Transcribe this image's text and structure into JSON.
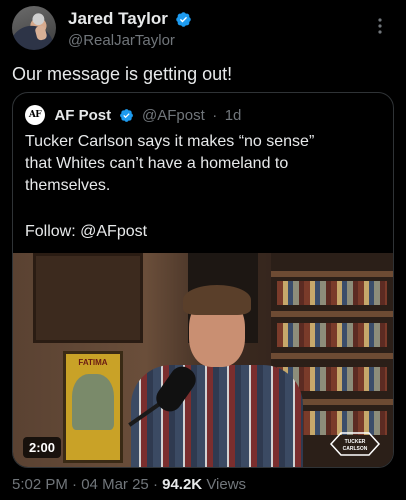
{
  "author": {
    "name": "Jared Taylor",
    "handle": "@RealJarTaylor"
  },
  "tweet": {
    "text": "Our message is getting out!"
  },
  "quoted": {
    "avatar_text": "AF",
    "name": "AF Post",
    "handle": "@AFpost",
    "separator": "·",
    "time": "1d",
    "body_lines": [
      "Tucker Carlson says it makes “no sense”",
      "that Whites can’t have a homeland to",
      "themselves."
    ],
    "follow": "Follow: @AFpost",
    "video": {
      "duration": "2:00",
      "poster_text": "FATIMA",
      "watermark_text": "TUCKER CARLSON"
    }
  },
  "meta": {
    "time": "5:02 PM",
    "sep1": "·",
    "date": "04 Mar 25",
    "sep2": "·",
    "views_count": "94.2K",
    "views_label": "Views"
  },
  "colors": {
    "background": "#000000",
    "text": "#e7e9ea",
    "secondary": "#71767b",
    "verified": "#1d9bf0",
    "border": "#2f3336"
  },
  "icons": {
    "verified": "verified-badge-icon",
    "more": "more-options-icon"
  }
}
